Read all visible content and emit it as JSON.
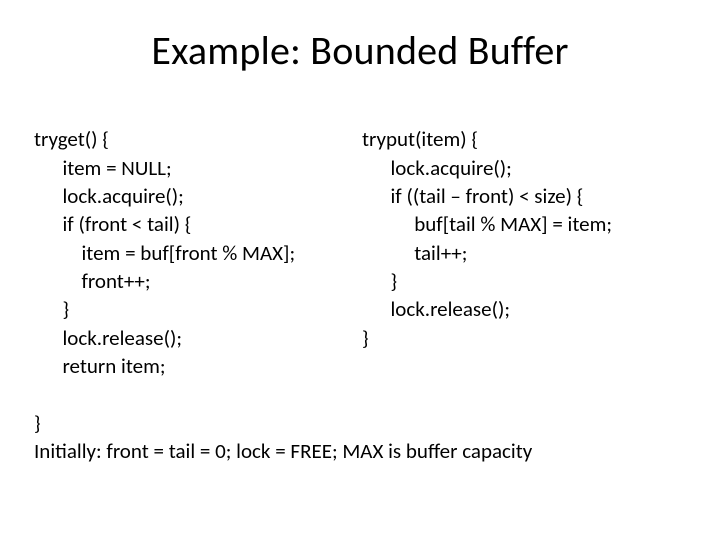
{
  "title": "Example: Bounded Buffer",
  "left": {
    "l1": "tryget() {",
    "l2": "      item = NULL;",
    "l3": "      lock.acquire();",
    "l4": "      if (front < tail) {",
    "l5": "          item = buf[front % MAX];",
    "l6": "          front++;",
    "l7": "      }",
    "l8": "      lock.release();",
    "l9": "      return item;",
    "l10": "}"
  },
  "right": {
    "r1": "tryput(item) {",
    "r2": "      lock.acquire();",
    "r3": "      if ((tail – front) < size) {",
    "r4": "           buf[tail % MAX] = item;",
    "r5": "           tail++;",
    "r6": "      }",
    "r7": "      lock.release();",
    "r8": "}"
  },
  "footer": "Initially: front = tail = 0; lock = FREE; MAX is buffer capacity"
}
